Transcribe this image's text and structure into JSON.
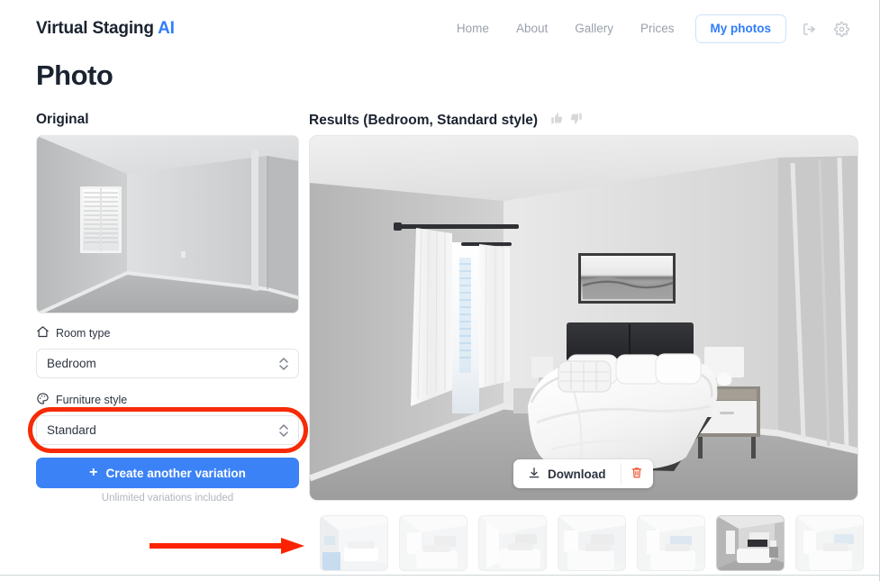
{
  "brand": {
    "name": "Virtual Staging",
    "accent_word": "AI",
    "accent_color": "#2f7dfa"
  },
  "nav": {
    "links": [
      {
        "label": "Home"
      },
      {
        "label": "About"
      },
      {
        "label": "Gallery"
      },
      {
        "label": "Prices"
      }
    ],
    "active_button": "My photos",
    "icons": [
      {
        "name": "logout-icon"
      },
      {
        "name": "settings-gear-icon"
      }
    ]
  },
  "page": {
    "title": "Photo"
  },
  "left_panel": {
    "heading": "Original",
    "original_image_alt": "Empty bedroom with window blinds and gray carpet",
    "room_type": {
      "label": "Room type",
      "icon": "home-icon",
      "value": "Bedroom"
    },
    "furniture_style": {
      "label": "Furniture style",
      "icon": "palette-icon",
      "value": "Standard"
    },
    "create_button": {
      "label": "Create another variation",
      "prefix": "+",
      "color": "#3b82f6"
    },
    "caption": "Unlimited variations included"
  },
  "right_panel": {
    "heading": "Results (Bedroom, Standard style)",
    "rating_icons": [
      {
        "name": "thumbs-up-icon"
      },
      {
        "name": "thumbs-down-icon"
      }
    ],
    "result_image_alt": "Staged bedroom with white bed, dark headboard and framed artwork",
    "download": {
      "label": "Download",
      "icon": "download-icon"
    },
    "delete": {
      "icon": "trash-icon",
      "color": "#f05a3c"
    },
    "thumbnails": [
      {
        "index": 1,
        "selected": false
      },
      {
        "index": 2,
        "selected": false
      },
      {
        "index": 3,
        "selected": false
      },
      {
        "index": 4,
        "selected": false
      },
      {
        "index": 5,
        "selected": false
      },
      {
        "index": 6,
        "selected": true
      },
      {
        "index": 7,
        "selected": false
      }
    ]
  },
  "annotations": [
    {
      "type": "ellipse",
      "target": "furniture-style-select",
      "color": "#f62b05"
    },
    {
      "type": "arrow",
      "target": "thumbnail-strip",
      "color": "#fc2400",
      "direction": "right"
    }
  ]
}
